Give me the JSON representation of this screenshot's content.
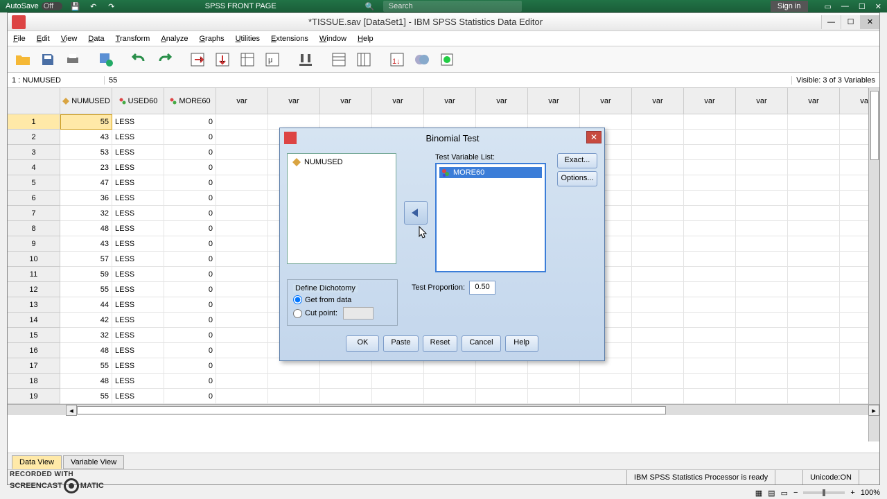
{
  "excel": {
    "autosave_label": "AutoSave",
    "autosave_state": "Off",
    "title": "SPSS FRONT PAGE",
    "search_placeholder": "Search",
    "signin": "Sign in"
  },
  "spss": {
    "title": "*TISSUE.sav [DataSet1] - IBM SPSS Statistics Data Editor",
    "menus": [
      "File",
      "Edit",
      "View",
      "Data",
      "Transform",
      "Analyze",
      "Graphs",
      "Utilities",
      "Extensions",
      "Window",
      "Help"
    ],
    "cellref_name": "1 : NUMUSED",
    "cellref_value": "55",
    "visible": "Visible: 3 of 3 Variables",
    "columns": [
      "NUMUSED",
      "USED60",
      "MORE60",
      "var",
      "var",
      "var",
      "var",
      "var",
      "var",
      "var",
      "var",
      "var",
      "var",
      "var",
      "var",
      "var"
    ],
    "rows": [
      {
        "n": 1,
        "a": "55",
        "b": "LESS",
        "c": "0"
      },
      {
        "n": 2,
        "a": "43",
        "b": "LESS",
        "c": "0"
      },
      {
        "n": 3,
        "a": "53",
        "b": "LESS",
        "c": "0"
      },
      {
        "n": 4,
        "a": "23",
        "b": "LESS",
        "c": "0"
      },
      {
        "n": 5,
        "a": "47",
        "b": "LESS",
        "c": "0"
      },
      {
        "n": 6,
        "a": "36",
        "b": "LESS",
        "c": "0"
      },
      {
        "n": 7,
        "a": "32",
        "b": "LESS",
        "c": "0"
      },
      {
        "n": 8,
        "a": "48",
        "b": "LESS",
        "c": "0"
      },
      {
        "n": 9,
        "a": "43",
        "b": "LESS",
        "c": "0"
      },
      {
        "n": 10,
        "a": "57",
        "b": "LESS",
        "c": "0"
      },
      {
        "n": 11,
        "a": "59",
        "b": "LESS",
        "c": "0"
      },
      {
        "n": 12,
        "a": "55",
        "b": "LESS",
        "c": "0"
      },
      {
        "n": 13,
        "a": "44",
        "b": "LESS",
        "c": "0"
      },
      {
        "n": 14,
        "a": "42",
        "b": "LESS",
        "c": "0"
      },
      {
        "n": 15,
        "a": "32",
        "b": "LESS",
        "c": "0"
      },
      {
        "n": 16,
        "a": "48",
        "b": "LESS",
        "c": "0"
      },
      {
        "n": 17,
        "a": "55",
        "b": "LESS",
        "c": "0"
      },
      {
        "n": 18,
        "a": "48",
        "b": "LESS",
        "c": "0"
      },
      {
        "n": 19,
        "a": "55",
        "b": "LESS",
        "c": "0"
      }
    ],
    "tabs": {
      "data": "Data View",
      "var": "Variable View"
    },
    "status_processor": "IBM SPSS Statistics Processor is ready",
    "status_unicode": "Unicode:ON",
    "zoom": "100%"
  },
  "dialog": {
    "title": "Binomial Test",
    "source_vars": [
      "NUMUSED"
    ],
    "test_var_label": "Test Variable List:",
    "test_vars": [
      "MORE60"
    ],
    "exact_btn": "Exact...",
    "options_btn": "Options...",
    "dichotomy_legend": "Define Dichotomy",
    "get_from_data": "Get from data",
    "cut_point": "Cut point:",
    "test_prop_label": "Test Proportion:",
    "test_prop_value": "0.50",
    "btns": {
      "ok": "OK",
      "paste": "Paste",
      "reset": "Reset",
      "cancel": "Cancel",
      "help": "Help"
    }
  },
  "watermark": {
    "l1": "RECORDED WITH",
    "l2a": "SCREENCAST",
    "l2b": "MATIC"
  }
}
